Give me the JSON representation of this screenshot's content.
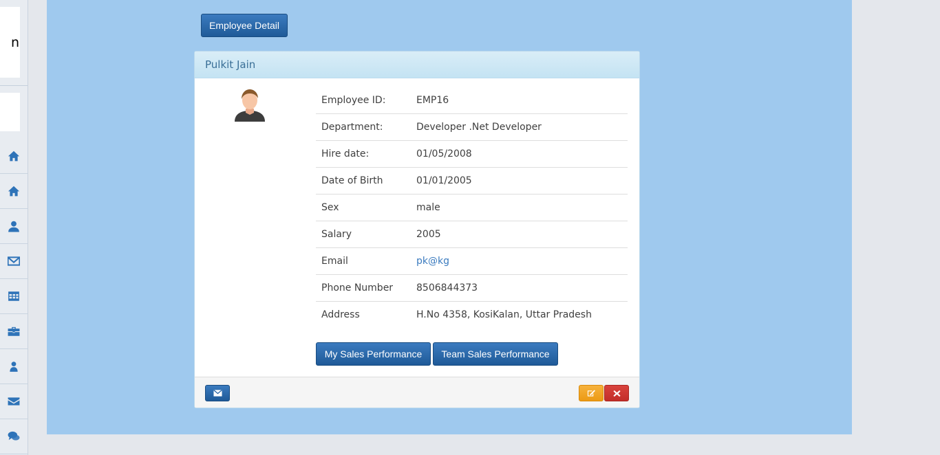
{
  "sidebar": {
    "logo_fragment": "n",
    "nav_icons": [
      "home-icon",
      "home-icon",
      "user-icon",
      "envelope-icon",
      "table-icon",
      "briefcase-icon",
      "user-icon",
      "envelope-icon",
      "comments-icon"
    ]
  },
  "header": {
    "employee_detail_label": "Employee Detail"
  },
  "panel": {
    "title": "Pulkit Jain",
    "rows": [
      {
        "label": "Employee ID:",
        "value": "EMP16"
      },
      {
        "label": "Department:",
        "value": "Developer .Net Developer"
      },
      {
        "label": "Hire date:",
        "value": "01/05/2008"
      },
      {
        "label": "Date of Birth",
        "value": "01/01/2005"
      },
      {
        "label": "Sex",
        "value": "male"
      },
      {
        "label": "Salary",
        "value": "2005"
      },
      {
        "label": "Email",
        "value": "pk@kg"
      },
      {
        "label": "Phone Number",
        "value": "8506844373"
      },
      {
        "label": "Address",
        "value": "H.No 4358, KosiKalan, Uttar Pradesh"
      }
    ],
    "my_sales_label": "My Sales Performance",
    "team_sales_label": "Team Sales Performance"
  },
  "colors": {
    "content_bg": "#9fc9ee",
    "primary": "#2a66a6",
    "warning": "#f0a22a",
    "danger": "#cf3732"
  }
}
